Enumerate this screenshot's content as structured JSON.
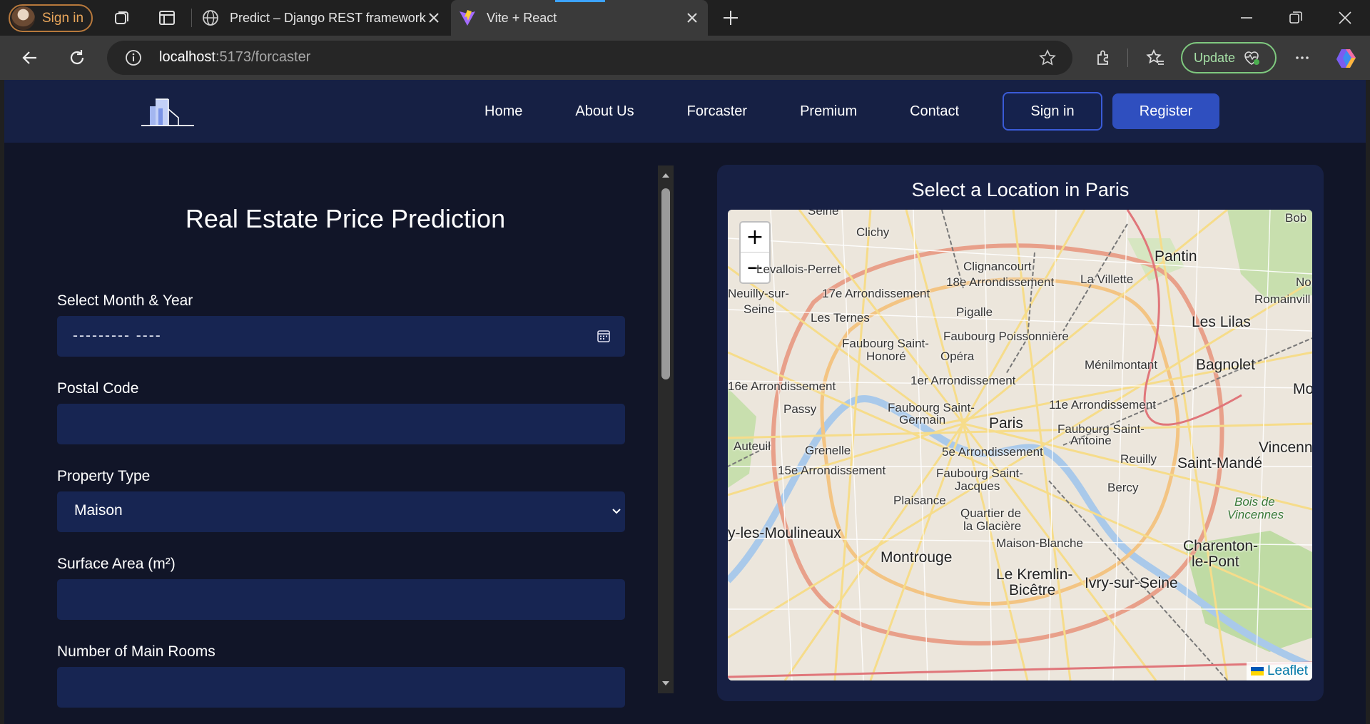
{
  "browser": {
    "profile_label": "Sign in",
    "tabs": [
      {
        "title": "Predict – Django REST framework",
        "icon": "globe-icon"
      },
      {
        "title": "Vite + React",
        "icon": "vite-icon"
      }
    ],
    "url_host": "localhost",
    "url_rest": ":5173/forcaster",
    "update_label": "Update"
  },
  "site": {
    "nav": [
      "Home",
      "About Us",
      "Forcaster",
      "Premium",
      "Contact"
    ],
    "signin_label": "Sign in",
    "register_label": "Register"
  },
  "form": {
    "title": "Real Estate Price Prediction",
    "month_label": "Select Month & Year",
    "month_placeholder": "--------- ----",
    "postal_label": "Postal Code",
    "postal_value": "",
    "type_label": "Property Type",
    "type_value": "Maison",
    "surface_label": "Surface Area (m²)",
    "surface_value": "",
    "rooms_label": "Number of Main Rooms",
    "rooms_value": ""
  },
  "map": {
    "title": "Select a Location in Paris",
    "zoom_in": "+",
    "zoom_out": "−",
    "attribution": "Leaflet",
    "labels": [
      "Seine",
      "Clichy",
      "Levallois-Perret",
      "Clignancourt",
      "Pantin",
      "Bob",
      "Neuilly-sur-",
      "Seine",
      "17e Arrondissement",
      "18e Arrondissement",
      "La Villette",
      "Noi",
      "Romainvill",
      "Les Ternes",
      "Pigalle",
      "Les Lilas",
      "Faubourg Saint-",
      "Honoré",
      "Faubourg Poissonnière",
      "Opéra",
      "Ménilmontant",
      "Bagnolet",
      "16e Arrondissement",
      "1er Arrondissement",
      "Montre",
      "Passy",
      "Faubourg Saint-",
      "Germain",
      "Paris",
      "11e Arrondissement",
      "Faubourg Saint-",
      "Antoine",
      "Auteuil",
      "Grenelle",
      "5e Arrondissement",
      "Reuilly",
      "Vincenn",
      "Saint-Mandé",
      "15e Arrondissement",
      "Faubourg Saint-",
      "Jacques",
      "Bercy",
      "Bois de",
      "Vincennes",
      "Plaisance",
      "Quartier de",
      "la Glacière",
      "y-les-Moulineaux",
      "Maison-Blanche",
      "Charenton-",
      "le-Pont",
      "Montrouge",
      "Le Kremlin-",
      "Bicêtre",
      "Ivry-sur-Seine"
    ]
  }
}
